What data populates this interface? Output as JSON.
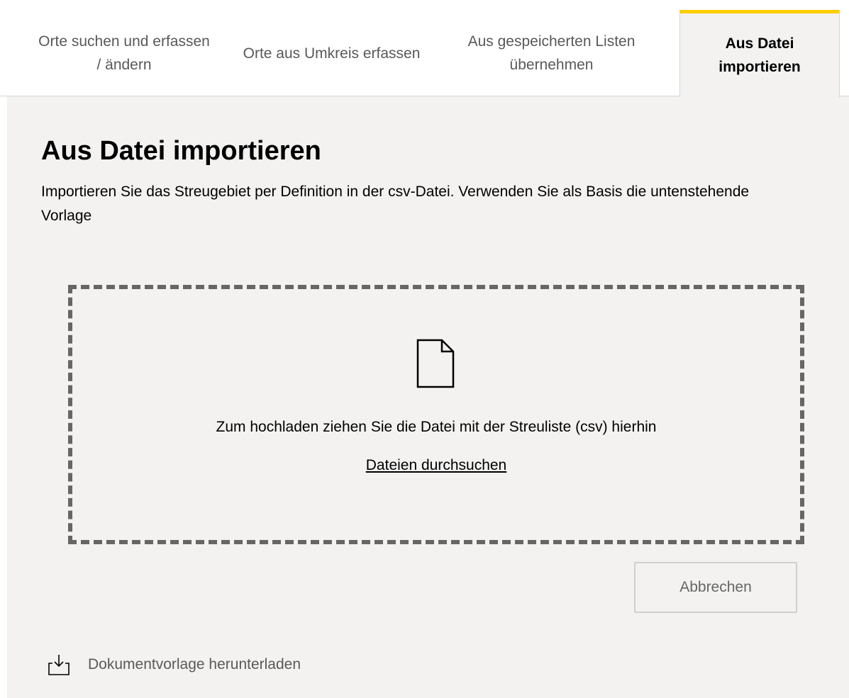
{
  "tabs": [
    {
      "label": "Orte suchen und erfassen / ändern",
      "active": false
    },
    {
      "label": "Orte aus Umkreis erfassen",
      "active": false
    },
    {
      "label": "Aus gespeicherten Listen übernehmen",
      "active": false
    },
    {
      "label": "Aus Datei importieren",
      "active": true
    }
  ],
  "colors": {
    "accent": "#ffcc00",
    "panel_background": "#f3f2f1",
    "dropzone_border": "#666666"
  },
  "panel": {
    "title": "Aus Datei importieren",
    "description": "Importieren Sie das Streugebiet per Definition in der csv-Datei. Verwenden Sie als Basis die untenstehende Vorlage"
  },
  "dropzone": {
    "icon": "file-icon",
    "instruction": "Zum hochladen ziehen Sie die Datei mit der Streuliste (csv) hierhin",
    "browse_link": "Dateien durchsuchen"
  },
  "actions": {
    "cancel_label": "Abbrechen"
  },
  "download": {
    "icon": "download-icon",
    "label": "Dokumentvorlage herunterladen"
  }
}
